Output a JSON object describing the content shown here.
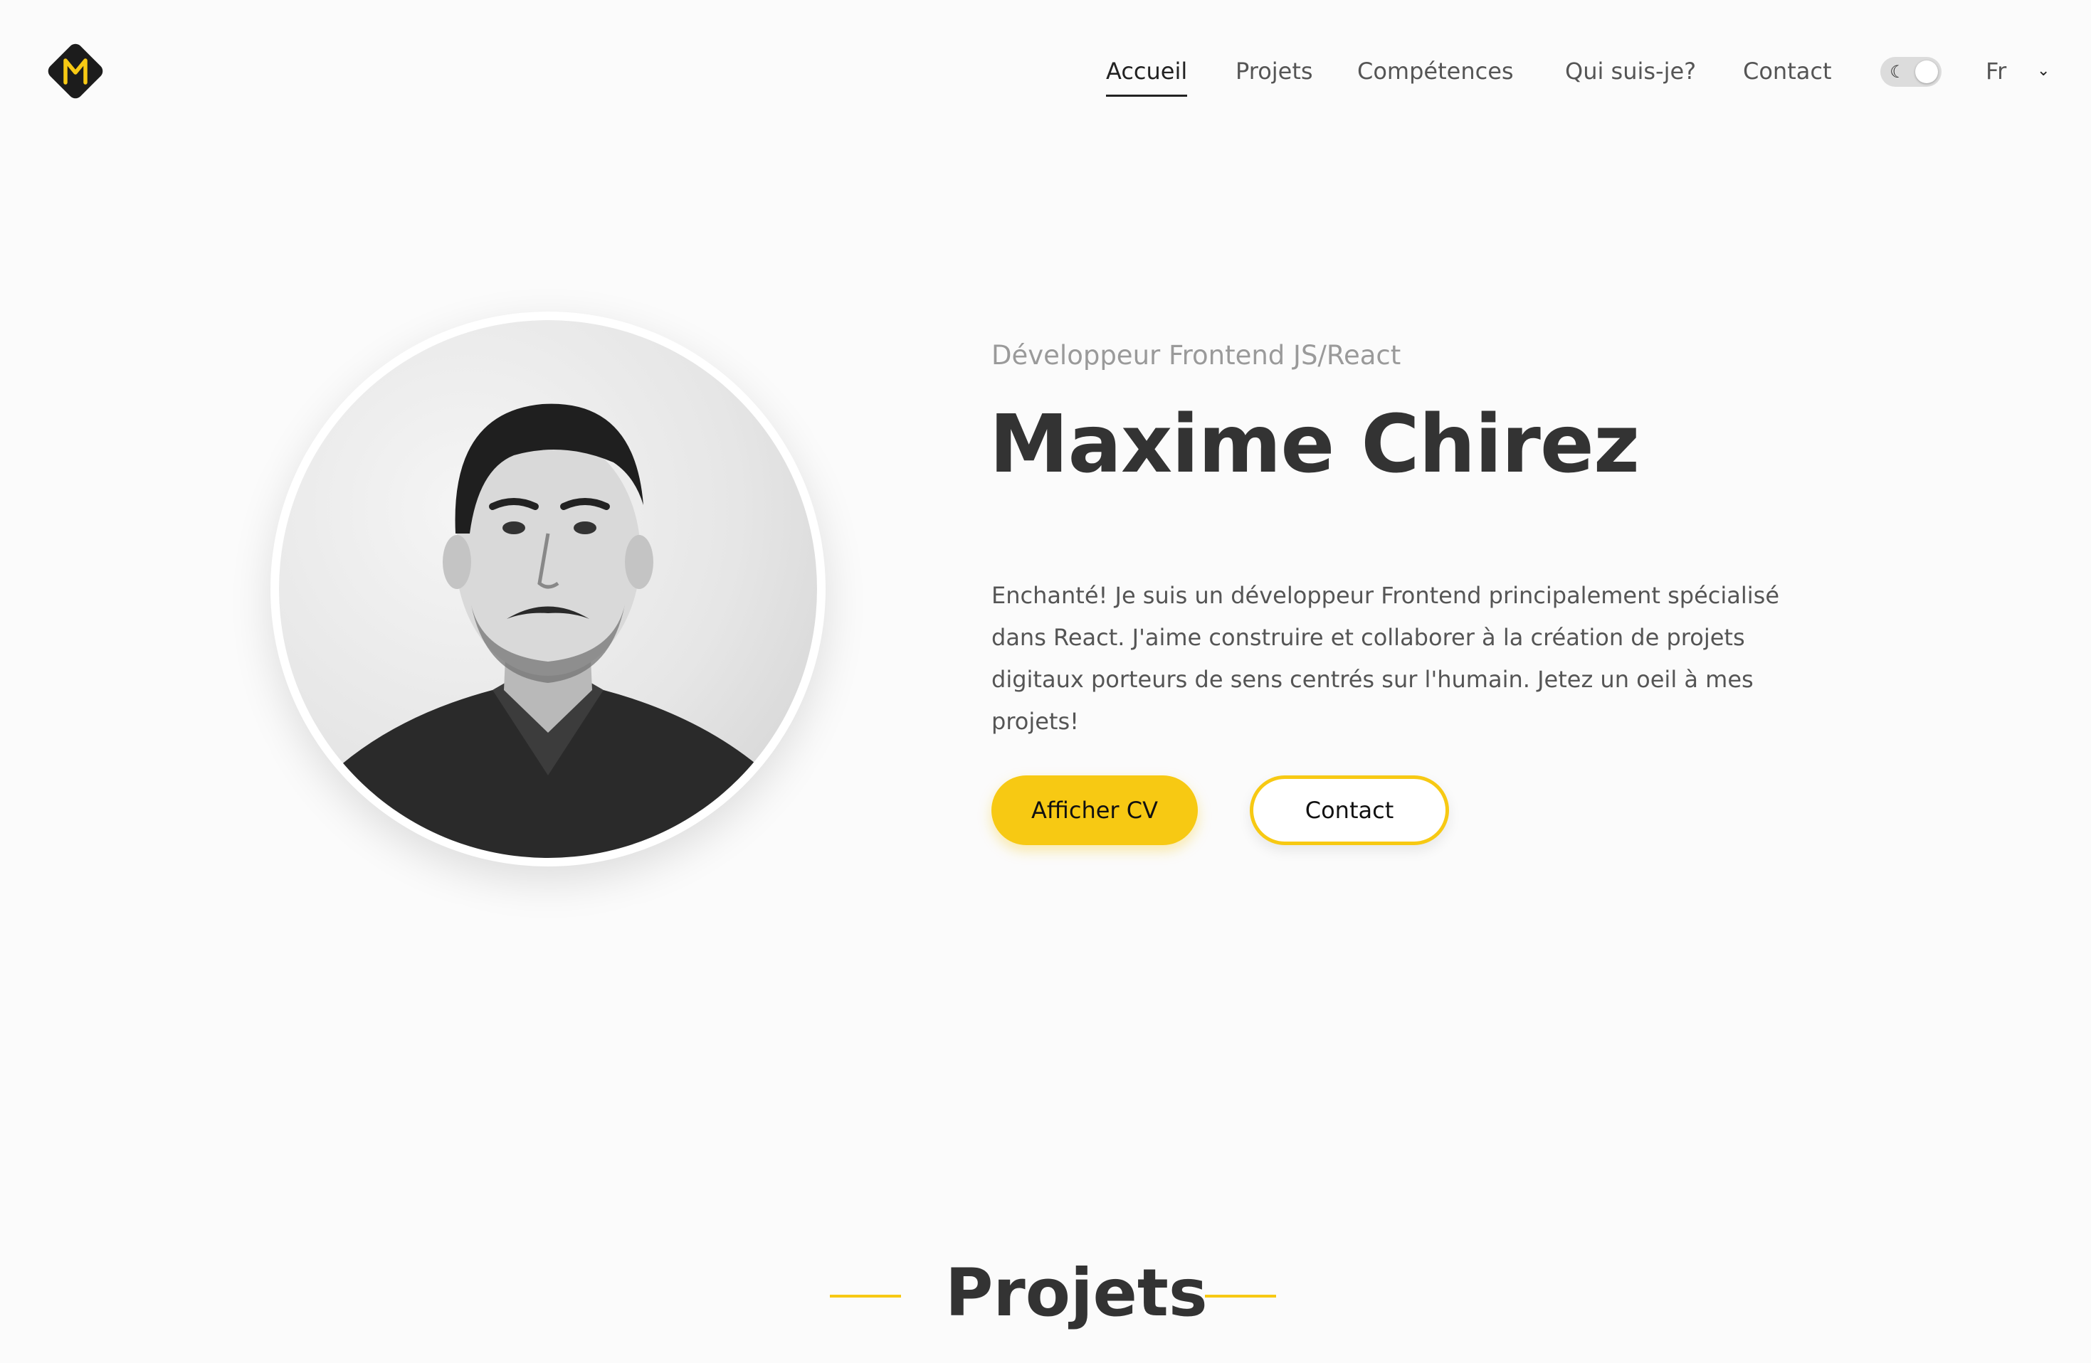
{
  "header": {
    "logo_letter": "M",
    "nav": [
      {
        "label": "Accueil",
        "active": true
      },
      {
        "label": "Projets",
        "active": false
      },
      {
        "label": "Compétences",
        "active": false
      },
      {
        "label": "Qui suis-je?",
        "active": false
      },
      {
        "label": "Contact",
        "active": false
      }
    ],
    "theme_toggle_icon": "moon-icon",
    "language": "Fr"
  },
  "hero": {
    "subtitle": "Développeur Frontend JS/React",
    "name": "Maxime Chirez",
    "intro": "Enchanté! Je suis un développeur Frontend principalement spécialisé dans React. J'aime construire et collaborer à la création de projets digitaux porteurs de sens centrés sur l'humain. Jetez un oeil à mes projets!",
    "primary_button": "Afficher CV",
    "secondary_button": "Contact"
  },
  "section": {
    "title": "Projets"
  },
  "colors": {
    "accent": "#f7c913",
    "logo_bg": "#1c1c1c",
    "text": "#333333",
    "muted": "#9a9a9a"
  }
}
